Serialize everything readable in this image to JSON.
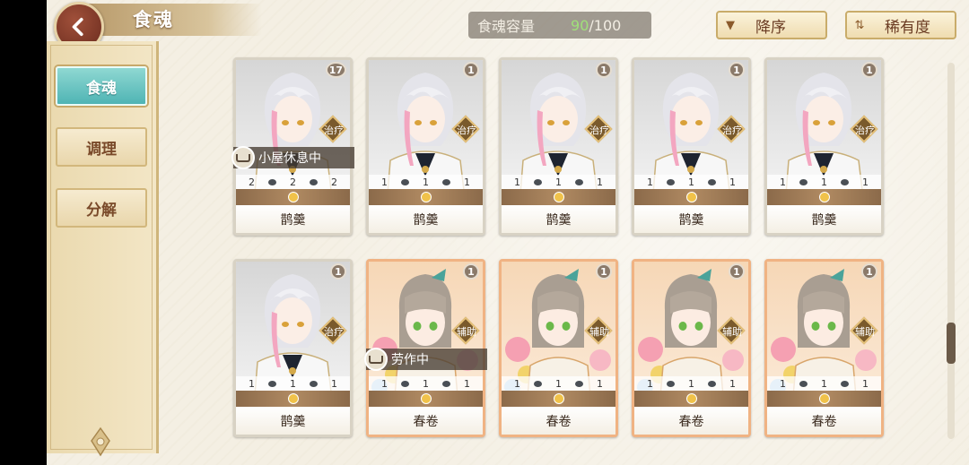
{
  "header": {
    "title": "食魂",
    "capacity_label": "食魂容量",
    "capacity_current": "90",
    "capacity_max": "/100",
    "sort_desc_label": "降序",
    "sort_rarity_label": "稀有度"
  },
  "sidebar": {
    "tabs": [
      {
        "label": "食魂",
        "active": true
      },
      {
        "label": "调理",
        "active": false
      },
      {
        "label": "分解",
        "active": false
      }
    ]
  },
  "cards": [
    {
      "name": "鹊羹",
      "level": "17",
      "role": "治疗",
      "stats": [
        "2",
        "2",
        "2"
      ],
      "status": "小屋休息中",
      "theme": "silver"
    },
    {
      "name": "鹊羹",
      "level": "1",
      "role": "治疗",
      "stats": [
        "1",
        "1",
        "1"
      ],
      "status": "",
      "theme": "silver"
    },
    {
      "name": "鹊羹",
      "level": "1",
      "role": "治疗",
      "stats": [
        "1",
        "1",
        "1"
      ],
      "status": "",
      "theme": "silver"
    },
    {
      "name": "鹊羹",
      "level": "1",
      "role": "治疗",
      "stats": [
        "1",
        "1",
        "1"
      ],
      "status": "",
      "theme": "silver"
    },
    {
      "name": "鹊羹",
      "level": "1",
      "role": "治疗",
      "stats": [
        "1",
        "1",
        "1"
      ],
      "status": "",
      "theme": "silver"
    },
    {
      "name": "鹊羹",
      "level": "1",
      "role": "治疗",
      "stats": [
        "1",
        "1",
        "1"
      ],
      "status": "",
      "theme": "silver"
    },
    {
      "name": "春卷",
      "level": "1",
      "role": "辅助",
      "stats": [
        "1",
        "1",
        "1"
      ],
      "status": "劳作中",
      "theme": "orange"
    },
    {
      "name": "春卷",
      "level": "1",
      "role": "辅助",
      "stats": [
        "1",
        "1",
        "1"
      ],
      "status": "",
      "theme": "orange"
    },
    {
      "name": "春卷",
      "level": "1",
      "role": "辅助",
      "stats": [
        "1",
        "1",
        "1"
      ],
      "status": "",
      "theme": "orange"
    },
    {
      "name": "春卷",
      "level": "1",
      "role": "辅助",
      "stats": [
        "1",
        "1",
        "1"
      ],
      "status": "",
      "theme": "orange"
    }
  ]
}
